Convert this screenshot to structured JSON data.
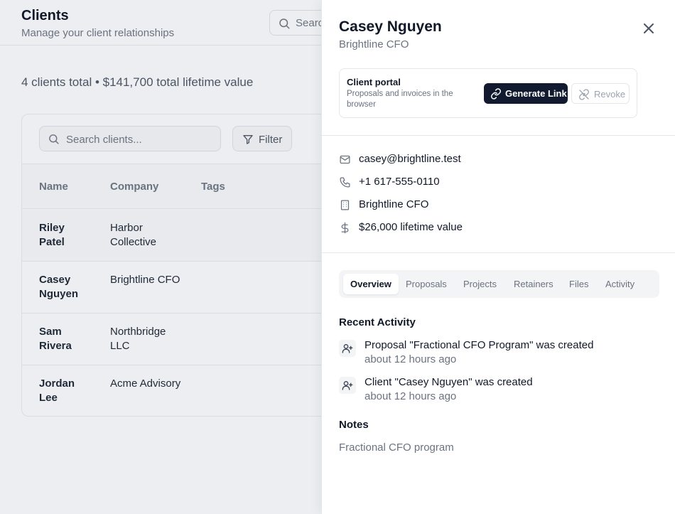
{
  "page": {
    "title": "Clients",
    "subtitle": "Manage your client relationships",
    "header_search_placeholder": "Search",
    "summary": "4 clients total • $141,700 total lifetime value"
  },
  "table": {
    "search_placeholder": "Search clients...",
    "filter_label": "Filter",
    "columns": [
      "Name",
      "Company",
      "Tags"
    ],
    "rows": [
      {
        "name": "Riley Patel",
        "company": "Harbor Collective"
      },
      {
        "name": "Casey Nguyen",
        "company": "Brightline CFO"
      },
      {
        "name": "Sam Rivera",
        "company": "Northbridge LLC"
      },
      {
        "name": "Jordan Lee",
        "company": "Acme Advisory"
      }
    ]
  },
  "drawer": {
    "name": "Casey Nguyen",
    "company": "Brightline CFO",
    "portal": {
      "title": "Client portal",
      "description": "Proposals and invoices in the browser",
      "generate_label": "Generate Link",
      "revoke_label": "Revoke"
    },
    "contact": {
      "email": "casey@brightline.test",
      "phone": "+1 617-555-0110",
      "company": "Brightline CFO",
      "lifetime_value": "$26,000 lifetime value"
    },
    "tabs": [
      "Overview",
      "Proposals",
      "Projects",
      "Retainers",
      "Files",
      "Activity"
    ],
    "active_tab": "Overview",
    "recent_activity_title": "Recent Activity",
    "activity": [
      {
        "text": "Proposal \"Fractional CFO Program\" was created",
        "time": "about 12 hours ago",
        "icon": "user-plus-icon"
      },
      {
        "text": "Client \"Casey Nguyen\" was created",
        "time": "about 12 hours ago",
        "icon": "user-plus-icon"
      }
    ],
    "notes_title": "Notes",
    "notes": "Fractional CFO program"
  },
  "colors": {
    "primary_button": "#111a2e",
    "background": "#eceef1",
    "drawer": "#ffffff",
    "muted_text": "#6b7280"
  }
}
